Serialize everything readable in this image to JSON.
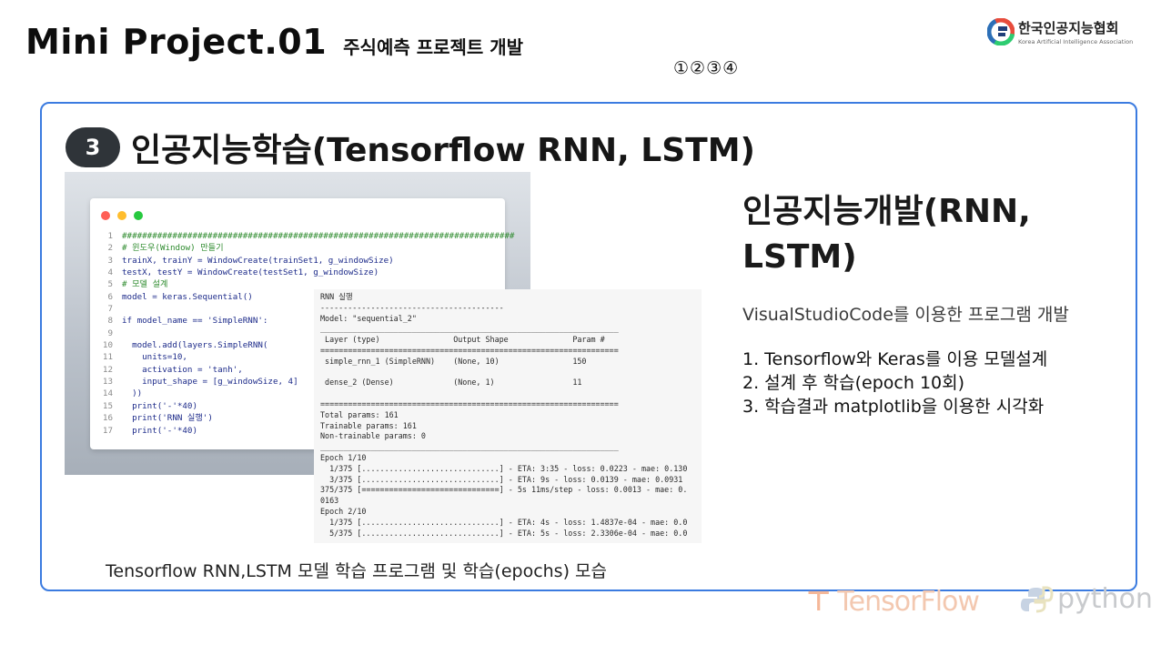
{
  "header": {
    "title": "Mini Project.01",
    "subtitle": "주식예측 프로젝트 개발",
    "step_markers": "①②③④"
  },
  "org": {
    "name": "한국인공지능협회",
    "name_en": "Korea Artificial Intelligence Association",
    "icon": "kaia-logo-icon"
  },
  "section": {
    "number": "3",
    "title": "인공지능학습(Tensorflow RNN, LSTM)"
  },
  "code": {
    "dots": [
      "#ff5f56",
      "#ffbd2e",
      "#27c93f"
    ],
    "lines": [
      {
        "n": "1",
        "text": "##############################################################################",
        "type": "comment"
      },
      {
        "n": "2",
        "text": "# 윈도우(Window) 만들기",
        "type": "comment"
      },
      {
        "n": "3",
        "text": "trainX, trainY = WindowCreate(trainSet1, g_windowSize)",
        "type": "code"
      },
      {
        "n": "4",
        "text": "testX, testY = WindowCreate(testSet1, g_windowSize)",
        "type": "code"
      },
      {
        "n": "5",
        "text": "# 모델 설계",
        "type": "comment"
      },
      {
        "n": "6",
        "text": "model = keras.Sequential()",
        "type": "code"
      },
      {
        "n": "7",
        "text": "",
        "type": "code"
      },
      {
        "n": "8",
        "text": "if model_name == 'SimpleRNN':",
        "type": "code"
      },
      {
        "n": "9",
        "text": "",
        "type": "code"
      },
      {
        "n": "10",
        "text": "  model.add(layers.SimpleRNN(",
        "type": "code"
      },
      {
        "n": "11",
        "text": "    units=10,",
        "type": "code"
      },
      {
        "n": "12",
        "text": "    activation = 'tanh',",
        "type": "code"
      },
      {
        "n": "13",
        "text": "    input_shape = [g_windowSize, 4]",
        "type": "code"
      },
      {
        "n": "14",
        "text": "  ))",
        "type": "code"
      },
      {
        "n": "15",
        "text": "  print('-'*40)",
        "type": "code"
      },
      {
        "n": "16",
        "text": "  print('RNN 실행')",
        "type": "code"
      },
      {
        "n": "17",
        "text": "  print('-'*40)",
        "type": "code"
      }
    ]
  },
  "console": {
    "lines": [
      "RNN 실행",
      "----------------------------------------",
      "Model: \"sequential_2\"",
      "_________________________________________________________________",
      " Layer (type)                Output Shape              Param #",
      "=================================================================",
      " simple_rnn_1 (SimpleRNN)    (None, 10)                150",
      "",
      " dense_2 (Dense)             (None, 1)                 11",
      "",
      "=================================================================",
      "Total params: 161",
      "Trainable params: 161",
      "Non-trainable params: 0",
      "_________________________________________________________________",
      "Epoch 1/10",
      "  1/375 [..............................] - ETA: 3:35 - loss: 0.0223 - mae: 0.130",
      "  3/375 [..............................] - ETA: 9s - loss: 0.0139 - mae: 0.0931",
      "375/375 [==============================] - 5s 11ms/step - loss: 0.0013 - mae: 0.",
      "0163",
      "Epoch 2/10",
      "  1/375 [..............................] - ETA: 4s - loss: 1.4837e-04 - mae: 0.0",
      "  5/375 [..............................] - ETA: 5s - loss: 2.3306e-04 - mae: 0.0"
    ]
  },
  "right": {
    "heading": "인공지능개발(RNN, LSTM)",
    "description": "VisualStudioCode를 이용한 프로그램 개발",
    "steps": [
      "1. Tensorflow와 Keras를 이용 모델설계",
      "2. 설계 후 학습(epoch 10회)",
      "3. 학습결과 matplotlib을 이용한 시각화"
    ]
  },
  "caption": "Tensorflow RNN,LSTM 모델 학습 프로그램 및 학습(epochs) 모습",
  "watermarks": {
    "tensorflow": "TensorFlow",
    "python": "python"
  },
  "colors": {
    "card_border": "#3b7be0",
    "badge_bg": "#2f3439",
    "code_blue": "#1d2b8a",
    "code_green": "#2e8b2e"
  }
}
